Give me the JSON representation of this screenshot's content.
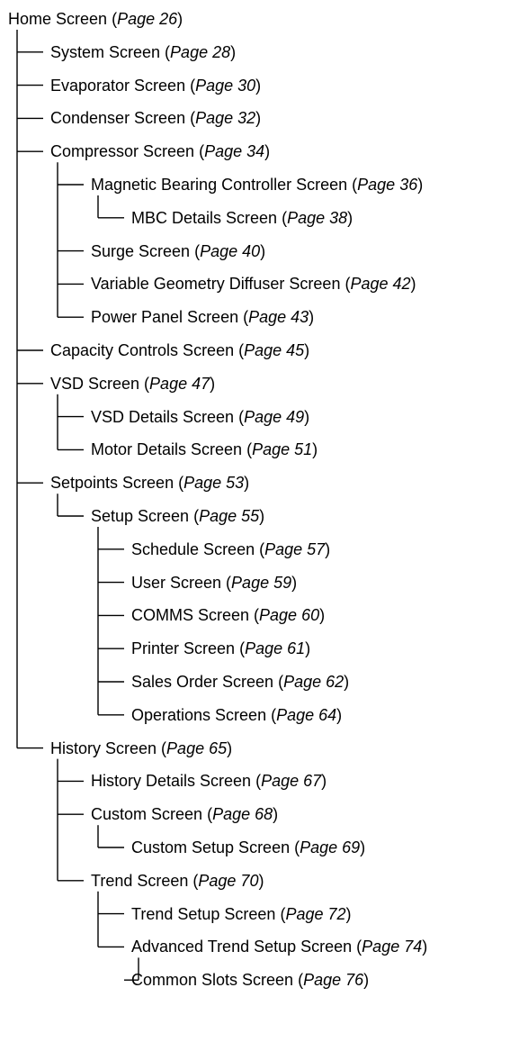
{
  "nodes": [
    {
      "id": "home",
      "parent": null,
      "label": "Home Screen",
      "page": "Page 26"
    },
    {
      "id": "system",
      "parent": "home",
      "label": "System Screen",
      "page": "Page 28"
    },
    {
      "id": "evaporator",
      "parent": "home",
      "label": "Evaporator Screen",
      "page": "Page 30"
    },
    {
      "id": "condenser",
      "parent": "home",
      "label": "Condenser Screen",
      "page": "Page 32"
    },
    {
      "id": "compressor",
      "parent": "home",
      "label": "Compressor Screen",
      "page": "Page 34"
    },
    {
      "id": "mbc",
      "parent": "compressor",
      "label": "Magnetic Bearing Controller Screen",
      "page": "Page 36"
    },
    {
      "id": "mbc-details",
      "parent": "mbc",
      "label": "MBC Details Screen",
      "page": "Page 38"
    },
    {
      "id": "surge",
      "parent": "compressor",
      "label": "Surge Screen",
      "page": "Page 40"
    },
    {
      "id": "vgd",
      "parent": "compressor",
      "label": "Variable Geometry Diffuser Screen",
      "page": "Page 42"
    },
    {
      "id": "power-panel",
      "parent": "compressor",
      "label": "Power Panel Screen",
      "page": "Page 43"
    },
    {
      "id": "capacity-controls",
      "parent": "home",
      "label": "Capacity Controls Screen",
      "page": "Page 45"
    },
    {
      "id": "vsd",
      "parent": "home",
      "label": "VSD Screen",
      "page": "Page 47"
    },
    {
      "id": "vsd-details",
      "parent": "vsd",
      "label": "VSD Details Screen",
      "page": "Page 49"
    },
    {
      "id": "motor-details",
      "parent": "vsd",
      "label": "Motor Details Screen",
      "page": "Page 51"
    },
    {
      "id": "setpoints",
      "parent": "home",
      "label": "Setpoints Screen",
      "page": "Page 53"
    },
    {
      "id": "setup",
      "parent": "setpoints",
      "label": "Setup Screen",
      "page": "Page 55"
    },
    {
      "id": "schedule",
      "parent": "setup",
      "label": "Schedule Screen",
      "page": "Page 57"
    },
    {
      "id": "user",
      "parent": "setup",
      "label": "User Screen",
      "page": "Page 59"
    },
    {
      "id": "comms",
      "parent": "setup",
      "label": "COMMS Screen",
      "page": "Page 60"
    },
    {
      "id": "printer",
      "parent": "setup",
      "label": "Printer Screen",
      "page": "Page 61"
    },
    {
      "id": "sales-order",
      "parent": "setup",
      "label": "Sales Order Screen",
      "page": "Page 62"
    },
    {
      "id": "operations",
      "parent": "setup",
      "label": "Operations Screen",
      "page": "Page 64"
    },
    {
      "id": "history",
      "parent": "home",
      "label": "History Screen",
      "page": "Page 65"
    },
    {
      "id": "history-details",
      "parent": "history",
      "label": "History Details Screen",
      "page": "Page 67"
    },
    {
      "id": "custom",
      "parent": "history",
      "label": "Custom Screen",
      "page": "Page 68"
    },
    {
      "id": "custom-setup",
      "parent": "custom",
      "label": "Custom Setup Screen",
      "page": "Page 69"
    },
    {
      "id": "trend",
      "parent": "history",
      "label": "Trend Screen",
      "page": "Page 70"
    },
    {
      "id": "trend-setup",
      "parent": "trend",
      "label": "Trend Setup Screen",
      "page": "Page 72"
    },
    {
      "id": "advanced-trend-setup",
      "parent": "trend",
      "label": "Advanced Trend Setup Screen",
      "page": "Page 74"
    },
    {
      "id": "common-slots",
      "parent": "advanced-trend-setup",
      "label": "Common Slots Screen",
      "page": "Page 76"
    }
  ]
}
